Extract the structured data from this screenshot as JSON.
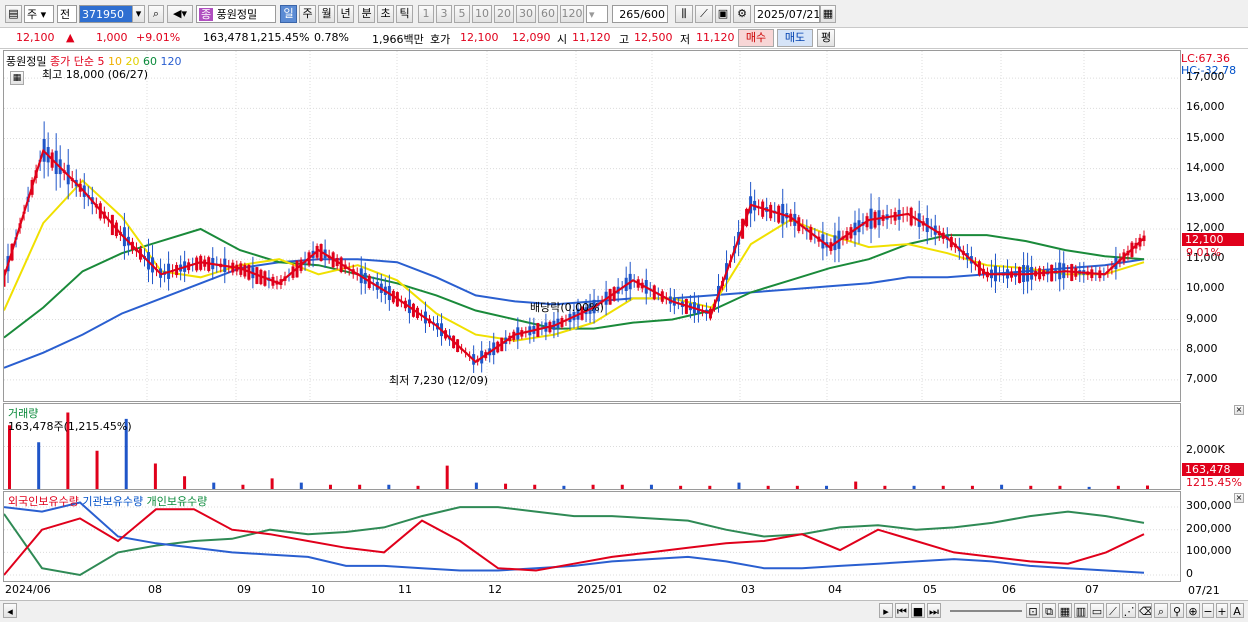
{
  "toolbar": {
    "period_select": "주",
    "prev_label": "전",
    "code": "371950",
    "stock_tag": "종",
    "stock_name": "풍원정밀",
    "periods": [
      "일",
      "주",
      "월",
      "년",
      "분",
      "초",
      "틱"
    ],
    "intervals": [
      "1",
      "3",
      "5",
      "10",
      "20",
      "30",
      "60",
      "120"
    ],
    "count": "265",
    "count_total": "/600",
    "date": "2025/07/21"
  },
  "quote": {
    "price": "12,100",
    "arrow": "▲",
    "change": "1,000",
    "change_pct": "+9.01%",
    "volume": "163,478",
    "volume_ratio": "1,215.45%",
    "turnover": "0.78%",
    "amount": "1,966백만",
    "ask_label": "호가",
    "ask1": "12,100",
    "ask2": "12,090",
    "open_label": "시",
    "open": "11,120",
    "high_label": "고",
    "high": "12,500",
    "low_label": "저",
    "low": "11,120",
    "buy": "매수",
    "sell": "매도",
    "avg": "평"
  },
  "chart_data": [
    {
      "type": "line",
      "title": "풍원정밀",
      "legend": [
        "종가 단순",
        "5",
        "10",
        "20",
        "60",
        "120"
      ],
      "lc": "LC:67.36",
      "hc": "HC:-32.78",
      "annotations": {
        "high": "최고 18,000 (06/27)",
        "low": "최저 7,230 (12/09)",
        "dividend": "배당락(0.00%)"
      },
      "current_price": "12,100",
      "current_pct": "9.01%",
      "ylim": [
        6300,
        17900
      ],
      "yticks": [
        "17,000",
        "16,000",
        "15,000",
        "14,000",
        "13,000",
        "12,000",
        "11,000",
        "10,000",
        "9,000",
        "8,000",
        "7,000"
      ],
      "xticks": [
        "2024/06",
        "08",
        "09",
        "10",
        "11",
        "12",
        "2025/01",
        "02",
        "03",
        "04",
        "05",
        "06",
        "07"
      ],
      "x_last": "07/21",
      "x_months": [
        0,
        1,
        2,
        3,
        4,
        5,
        6,
        7,
        8,
        9,
        10,
        11,
        12,
        13
      ],
      "ma5": [
        10400,
        14600,
        13300,
        11800,
        10500,
        10900,
        10700,
        10200,
        11300,
        10500,
        9700,
        8800,
        7600,
        8500,
        8800,
        9400,
        10300,
        9600,
        9200,
        12800,
        12400,
        11400,
        12300,
        12500,
        11700,
        10500,
        10500,
        10600,
        10500,
        11700
      ],
      "ma20": [
        9300,
        12200,
        13600,
        12400,
        10600,
        10400,
        10800,
        11000,
        10500,
        10800,
        10300,
        9200,
        8500,
        8300,
        8500,
        8900,
        9700,
        9700,
        9400,
        11500,
        12300,
        11800,
        11400,
        11500,
        11200,
        10800,
        10700,
        10500,
        10500,
        10900
      ],
      "ma60": [
        8400,
        9400,
        10600,
        11200,
        11600,
        12000,
        11300,
        10900,
        10800,
        10500,
        10200,
        9800,
        9300,
        9000,
        8700,
        8700,
        8900,
        9000,
        9300,
        9900,
        10300,
        10700,
        11000,
        11500,
        11800,
        11800,
        11600,
        11300,
        11100,
        11000
      ],
      "ma120": [
        7400,
        7900,
        8500,
        9200,
        9700,
        10200,
        10700,
        10900,
        11000,
        11000,
        10900,
        10400,
        9800,
        9600,
        9500,
        9600,
        9700,
        9700,
        9800,
        9900,
        10000,
        10100,
        10200,
        10400,
        10400,
        10500,
        10600,
        10700,
        10800,
        11000
      ],
      "volume_panel": {
        "title": "거래량",
        "info": "163,478주(1,215.45%)",
        "ytick": "2,000K",
        "last_value": "163,478",
        "last_pct": "1215.45%",
        "values_k": [
          3000,
          2200,
          3600,
          1800,
          3300,
          1200,
          600,
          300,
          200,
          500,
          300,
          200,
          200,
          200,
          150,
          1100,
          300,
          250,
          200,
          150,
          200,
          200,
          200,
          150,
          150,
          300,
          150,
          150,
          150,
          350,
          150,
          150,
          150,
          150,
          200,
          150,
          150,
          100,
          150,
          163
        ]
      },
      "holdings_panel": {
        "series": [
          "외국인보유수량",
          "기관보유수량",
          "개인보유수량"
        ],
        "yticks": [
          "300,000",
          "200,000",
          "100,000",
          "0"
        ],
        "ylim": [
          0,
          340000
        ],
        "foreign": [
          0,
          200000,
          250000,
          150000,
          290000,
          290000,
          200000,
          180000,
          150000,
          120000,
          100000,
          240000,
          150000,
          30000,
          20000,
          50000,
          80000,
          100000,
          120000,
          140000,
          150000,
          180000,
          110000,
          200000,
          150000,
          100000,
          80000,
          60000,
          50000,
          100000,
          180000
        ],
        "institution": [
          300000,
          280000,
          320000,
          170000,
          140000,
          120000,
          100000,
          90000,
          80000,
          40000,
          40000,
          30000,
          20000,
          20000,
          30000,
          40000,
          60000,
          70000,
          80000,
          60000,
          30000,
          30000,
          40000,
          50000,
          60000,
          70000,
          60000,
          40000,
          30000,
          20000,
          10000
        ],
        "individual": [
          270000,
          30000,
          0,
          100000,
          130000,
          150000,
          160000,
          200000,
          180000,
          190000,
          210000,
          260000,
          300000,
          300000,
          280000,
          260000,
          260000,
          250000,
          240000,
          200000,
          170000,
          180000,
          210000,
          220000,
          200000,
          210000,
          230000,
          260000,
          280000,
          260000,
          230000
        ]
      }
    }
  ]
}
